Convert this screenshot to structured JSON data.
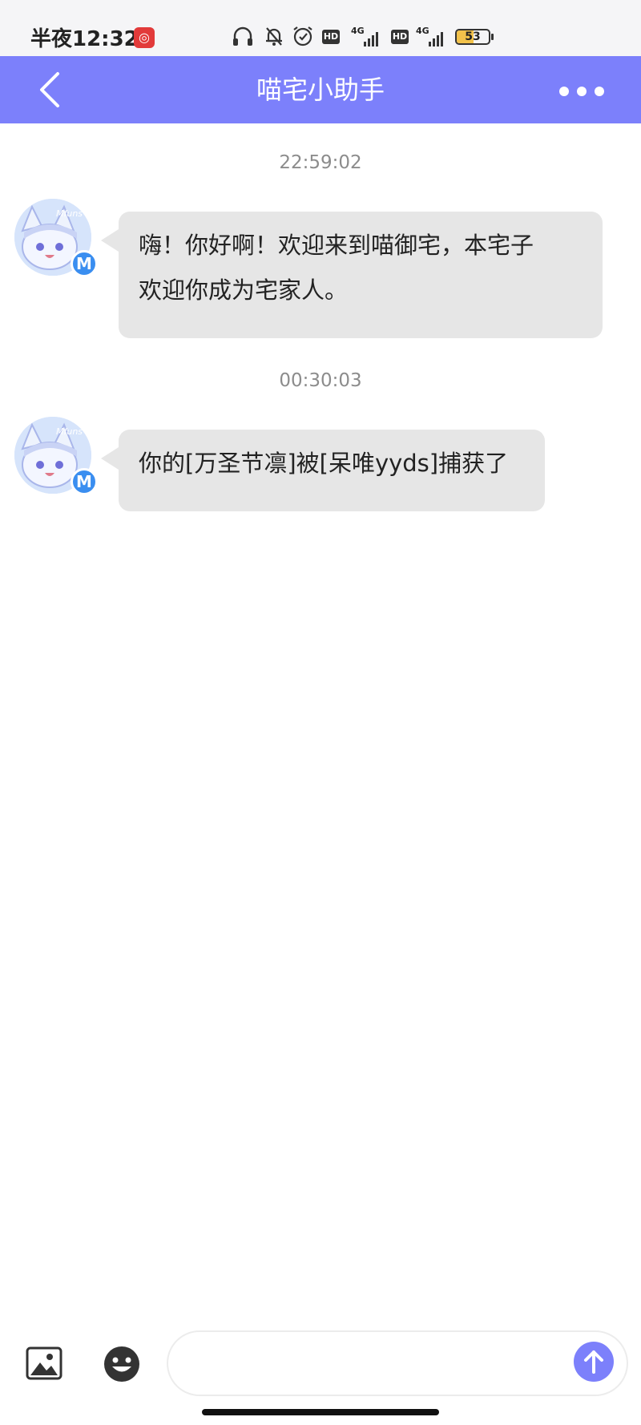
{
  "status_bar": {
    "time": "半夜12:32",
    "network1": "4G",
    "network2": "4G",
    "hd1": "HD",
    "hd2": "HD",
    "battery_percent": "53",
    "battery_level": 0.53
  },
  "header": {
    "title": "喵宅小助手"
  },
  "messages": [
    {
      "timestamp": "22:59:02",
      "line1": "嗨！你好啊！欢迎来到喵御宅，本宅子",
      "line2": "欢迎你成为宅家人。"
    },
    {
      "timestamp": "00:30:03",
      "line1": "你的[万圣节凛]被[呆唯yyds]捕获了"
    }
  ],
  "avatar": {
    "text": "Mfuns",
    "badge": "M"
  },
  "colors": {
    "accent": "#7c80fb",
    "bubble": "#e6e6e6",
    "timestamp": "#8c8c8c",
    "badge": "#3a8ef0"
  }
}
